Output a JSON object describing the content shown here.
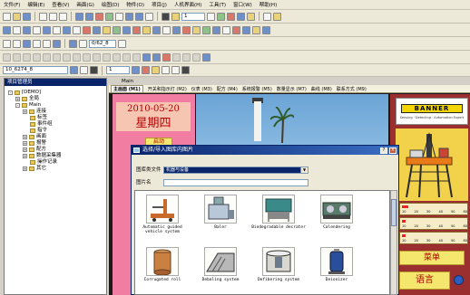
{
  "menu": [
    "文件(F)",
    "编辑(E)",
    "查看(V)",
    "画面(G)",
    "绘图(D)",
    "物件(O)",
    "项目(J)",
    "人机界面(H)",
    "工具(T)",
    "窗口(W)",
    "帮助(H)"
  ],
  "toolbar": {
    "zoom_value": "1",
    "page_select": "0/62_8",
    "page_code": "10_6274_8",
    "line_width": "1"
  },
  "tree": {
    "title": "项目管理员",
    "items": [
      {
        "label": "[DEMO]",
        "level": 0,
        "expand": "-"
      },
      {
        "label": "全局",
        "level": 1,
        "expand": "+"
      },
      {
        "label": "Main",
        "level": 1,
        "expand": "-"
      },
      {
        "label": "连接",
        "level": 2,
        "expand": "+"
      },
      {
        "label": "标签",
        "level": 2,
        "expand": ""
      },
      {
        "label": "事件组",
        "level": 2,
        "expand": ""
      },
      {
        "label": "指令",
        "level": 2,
        "expand": ""
      },
      {
        "label": "画面",
        "level": 2,
        "expand": "+"
      },
      {
        "label": "报警",
        "level": 2,
        "expand": "+"
      },
      {
        "label": "配方",
        "level": 2,
        "expand": "+"
      },
      {
        "label": "数据采集器",
        "level": 2,
        "expand": "+"
      },
      {
        "label": "操作记录",
        "level": 2,
        "expand": ""
      },
      {
        "label": "其它",
        "level": 2,
        "expand": "+"
      }
    ]
  },
  "canvas": {
    "title": "Main",
    "tabs": [
      "主画面 (M1)",
      "开关和指示灯 (M2)",
      "仪表 (M3)",
      "配方 (M4)",
      "系统报警 (M5)",
      "数量显示 (M7)",
      "曲线 (M8)",
      "联系方式 (M9)"
    ],
    "active_tab": 0,
    "date": "2010-05-20",
    "weekday": "星期四",
    "start_button": "启动",
    "menu_button": "菜单",
    "language_button": "语言"
  },
  "brand": {
    "logo_text": "BANNER",
    "tagline": "Sensing · Detecting · Automation Expert"
  },
  "gauges": [
    {
      "ticks": [
        "10",
        "20",
        "30",
        "40",
        "50",
        "60"
      ],
      "fill": 0.1
    },
    {
      "ticks": [
        "10",
        "20",
        "30",
        "40",
        "50",
        "60"
      ],
      "fill": 0.05
    },
    {
      "ticks": [
        "10",
        "20",
        "30",
        "40",
        "50",
        "60"
      ],
      "fill": 0.05
    }
  ],
  "dialog": {
    "title": "选择/导入图库内图片",
    "help_label": "?",
    "close_label": "×",
    "category_label": "图库类文件",
    "category_value": "机器与设备",
    "name_label": "图片名",
    "name_value": "",
    "images": [
      {
        "caption": "Automatic guided vehicle system",
        "icon": "agv-icon"
      },
      {
        "caption": "Baler",
        "icon": "baler-icon"
      },
      {
        "caption": "Biodegradable decrater",
        "icon": "decrater-icon"
      },
      {
        "caption": "Calendering",
        "icon": "calendering-icon"
      },
      {
        "caption": "Corrugated roll",
        "icon": "roll-icon"
      },
      {
        "caption": "Debaling system",
        "icon": "debaling-icon"
      },
      {
        "caption": "Defibering system",
        "icon": "defibering-icon"
      },
      {
        "caption": "Deionizer",
        "icon": "deionizer-icon"
      }
    ]
  },
  "colors": {
    "pink_panel": "#f27da2",
    "dark_red_panel": "#9b2f2f",
    "banner_yellow": "#f3d600",
    "title_blue": "#0a246a"
  }
}
